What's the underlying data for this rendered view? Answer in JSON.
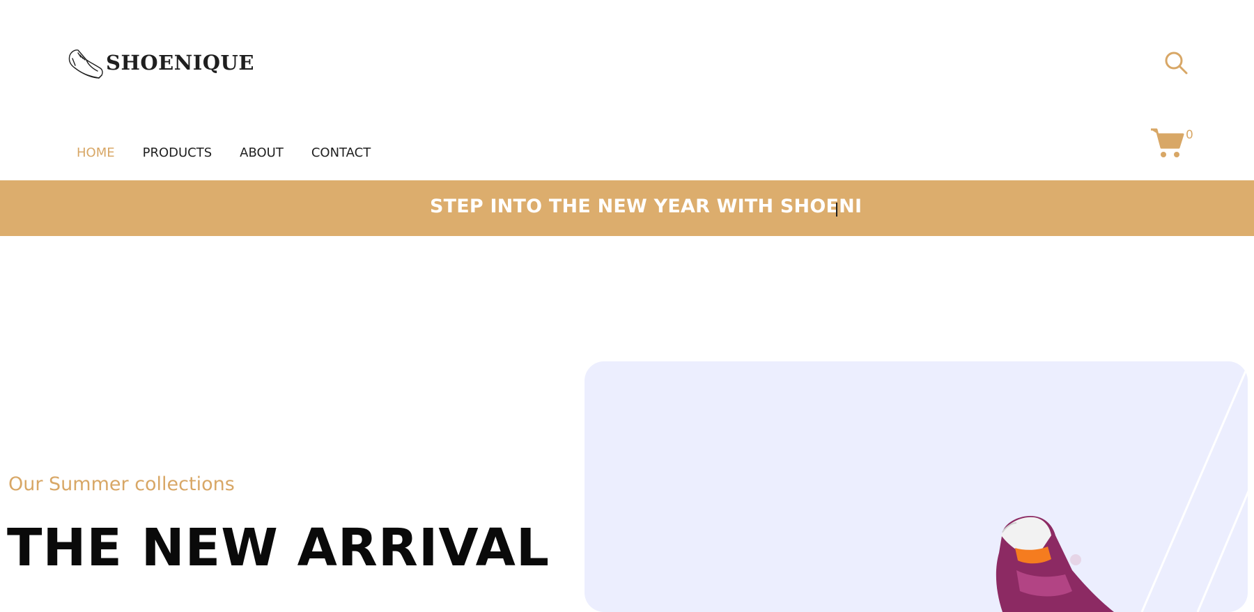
{
  "brand": {
    "name": "SHOENIQUE",
    "logo_icon": "sneaker-icon"
  },
  "header": {
    "search_icon": "search-icon",
    "cart_icon": "cart-icon",
    "cart_count": "0"
  },
  "nav": {
    "items": [
      {
        "label": "HOME",
        "active": true
      },
      {
        "label": "PRODUCTS",
        "active": false
      },
      {
        "label": "ABOUT",
        "active": false
      },
      {
        "label": "CONTACT",
        "active": false
      }
    ]
  },
  "banner": {
    "text": "STEP INTO THE NEW YEAR WITH SHOENI",
    "color": "#dcad6d"
  },
  "hero": {
    "subtitle": "Our Summer collections",
    "title": "THE NEW ARRIVAL",
    "card_color": "#eceefe",
    "accent_color": "#d8a766"
  }
}
